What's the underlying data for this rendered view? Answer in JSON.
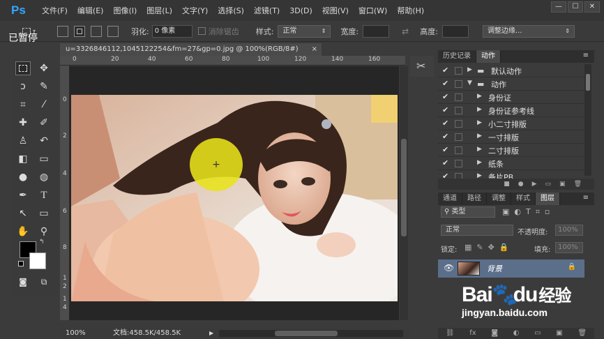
{
  "app": {
    "logo": "Ps",
    "paused_label": "已暂停",
    "menu": [
      "文件(F)",
      "编辑(E)",
      "图像(I)",
      "图层(L)",
      "文字(Y)",
      "选择(S)",
      "滤镜(T)",
      "3D(D)",
      "视图(V)",
      "窗口(W)",
      "帮助(H)"
    ],
    "window_controls": [
      "—",
      "☐",
      "✕"
    ]
  },
  "options": {
    "feather_label": "羽化:",
    "feather_value": "0 像素",
    "antialias_label": "消除锯齿",
    "style_label": "样式:",
    "style_value": "正常",
    "width_label": "宽度:",
    "height_label": "高度:",
    "refine_edge_label": "调整边缘..."
  },
  "document": {
    "tab_title": "u=3326846112,1045122254&fm=27&gp=0.jpg @ 100%(RGB/8#)",
    "close": "×",
    "ruler_top": [
      "0",
      "20",
      "40",
      "60",
      "80",
      "100",
      "120",
      "140",
      "160"
    ],
    "ruler_left": [
      "0",
      "2",
      "4",
      "6",
      "8",
      "1",
      "2",
      "1",
      "4",
      "1",
      "6"
    ],
    "status_zoom": "100%",
    "status_doc": "文档:458.5K/458.5K"
  },
  "actions_panel": {
    "tabs": [
      "历史记录",
      "动作"
    ],
    "active_tab": "动作",
    "rows": [
      {
        "label": "默认动作",
        "indent": 0,
        "folder": true,
        "open": false
      },
      {
        "label": "动作",
        "indent": 0,
        "folder": true,
        "open": true
      },
      {
        "label": "身份证",
        "indent": 1,
        "folder": false,
        "open": false
      },
      {
        "label": "身份证参考线",
        "indent": 1,
        "folder": false,
        "open": false
      },
      {
        "label": "小二寸排版",
        "indent": 1,
        "folder": false,
        "open": false
      },
      {
        "label": "一寸排版",
        "indent": 1,
        "folder": false,
        "open": false
      },
      {
        "label": "二寸排版",
        "indent": 1,
        "folder": false,
        "open": false
      },
      {
        "label": "纸条",
        "indent": 1,
        "folder": false,
        "open": false
      },
      {
        "label": "备片PB",
        "indent": 1,
        "folder": false,
        "open": false
      }
    ]
  },
  "layers_panel": {
    "tabs": [
      "通道",
      "路径",
      "调整",
      "样式",
      "图层"
    ],
    "active_tab": "图层",
    "filter_kind": "类型",
    "blend_mode": "正常",
    "opacity_label": "不透明度:",
    "opacity_value": "100%",
    "lock_label": "锁定:",
    "fill_label": "填充:",
    "fill_value": "100%",
    "layer_name": "背景"
  },
  "watermark": {
    "brand": "Bai",
    "brand_end": "du",
    "brand_cn": "经验",
    "url": "jingyan.baidu.com"
  },
  "colors": {
    "accent": "#31a8ff",
    "cursor_highlight": "#e8e21a",
    "layer_selected": "#5b6e8a"
  }
}
